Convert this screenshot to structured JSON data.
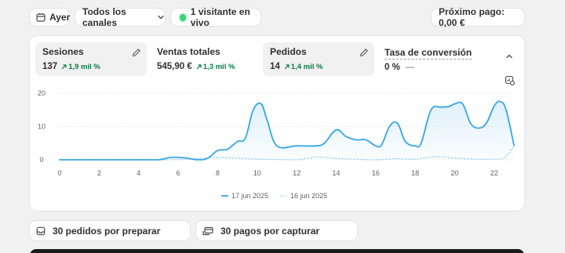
{
  "toolbar": {
    "date_label": "Ayer",
    "channel_label": "Todos los canales",
    "live_label": "1 visitante en vivo",
    "payout_label": "Próximo pago: 0,00 €"
  },
  "metrics": [
    {
      "label": "Sesiones",
      "value": "137",
      "delta": "1,9 mil %",
      "active": true
    },
    {
      "label": "Ventas totales",
      "value": "545,90 €",
      "delta": "1,3 mil %",
      "active": false
    },
    {
      "label": "Pedidos",
      "value": "14",
      "delta": "1,4 mil %",
      "active": true
    },
    {
      "label": "Tasa de conversión",
      "value": "0 %",
      "delta": "—",
      "active": false
    }
  ],
  "icons": {
    "date": "calendar-icon",
    "channel": "chevron-down-icon",
    "live": "live-dot-icon",
    "edit": "pencil-icon",
    "collapse": "chevron-up-icon",
    "chart_settings": "chart-settings-icon",
    "orders": "inbox-icon",
    "payments": "card-icon"
  },
  "chart_data": {
    "type": "line",
    "x_ticks": [
      "0",
      "2",
      "4",
      "6",
      "8",
      "10",
      "12",
      "14",
      "16",
      "18",
      "20",
      "22"
    ],
    "y_ticks": [
      "0",
      "10",
      "20"
    ],
    "ylim": [
      0,
      20
    ],
    "xlim": [
      0,
      23
    ],
    "series": [
      {
        "name": "17 jun 2025",
        "color": "#36a6e6",
        "style": "solid",
        "points": [
          [
            0,
            0
          ],
          [
            1,
            0
          ],
          [
            2,
            0
          ],
          [
            3,
            0
          ],
          [
            4,
            0
          ],
          [
            5,
            0
          ],
          [
            5.6,
            0.7
          ],
          [
            6.3,
            0.6
          ],
          [
            7,
            0
          ],
          [
            7.5,
            0.5
          ],
          [
            8,
            2.8
          ],
          [
            8.5,
            3.2
          ],
          [
            9,
            5.5
          ],
          [
            9.4,
            6.5
          ],
          [
            9.8,
            15
          ],
          [
            10.2,
            16.8
          ],
          [
            10.5,
            12
          ],
          [
            11,
            4.2
          ],
          [
            12,
            4.2
          ],
          [
            13,
            4.2
          ],
          [
            13.4,
            5
          ],
          [
            14,
            9
          ],
          [
            14.5,
            7
          ],
          [
            15,
            6
          ],
          [
            15.5,
            6
          ],
          [
            16,
            4.2
          ],
          [
            16.3,
            4.5
          ],
          [
            16.7,
            10
          ],
          [
            17.1,
            11
          ],
          [
            17.5,
            5.5
          ],
          [
            18,
            4.2
          ],
          [
            18.3,
            5
          ],
          [
            18.8,
            15
          ],
          [
            19.3,
            15.8
          ],
          [
            19.7,
            16
          ],
          [
            20,
            16.8
          ],
          [
            20.4,
            16.8
          ],
          [
            20.8,
            11
          ],
          [
            21.2,
            9.5
          ],
          [
            21.6,
            11
          ],
          [
            22,
            16.2
          ],
          [
            22.3,
            17.5
          ],
          [
            22.6,
            15
          ],
          [
            23,
            4.3
          ]
        ]
      },
      {
        "name": "16 jun 2025",
        "color": "#9fd3f2",
        "style": "dotted",
        "points": [
          [
            0,
            0
          ],
          [
            1,
            0
          ],
          [
            2,
            0
          ],
          [
            3,
            0
          ],
          [
            4,
            0
          ],
          [
            5,
            0
          ],
          [
            6,
            0.1
          ],
          [
            7,
            0.4
          ],
          [
            8,
            0.7
          ],
          [
            9,
            0.5
          ],
          [
            10,
            0.2
          ],
          [
            11,
            0.1
          ],
          [
            12,
            0
          ],
          [
            13,
            0.8
          ],
          [
            14,
            0.4
          ],
          [
            15,
            0.2
          ],
          [
            16,
            0
          ],
          [
            17,
            0.3
          ],
          [
            18,
            0.2
          ],
          [
            19,
            0.9
          ],
          [
            20,
            0.5
          ],
          [
            21,
            0.2
          ],
          [
            22,
            0.2
          ],
          [
            22.5,
            0.6
          ],
          [
            23,
            4
          ]
        ]
      }
    ]
  },
  "legend": [
    {
      "label": "17 jun 2025"
    },
    {
      "label": "16 jun 2025"
    }
  ],
  "tasks": [
    {
      "label": "30 pedidos por preparar"
    },
    {
      "label": "30 pagos por capturar"
    }
  ]
}
